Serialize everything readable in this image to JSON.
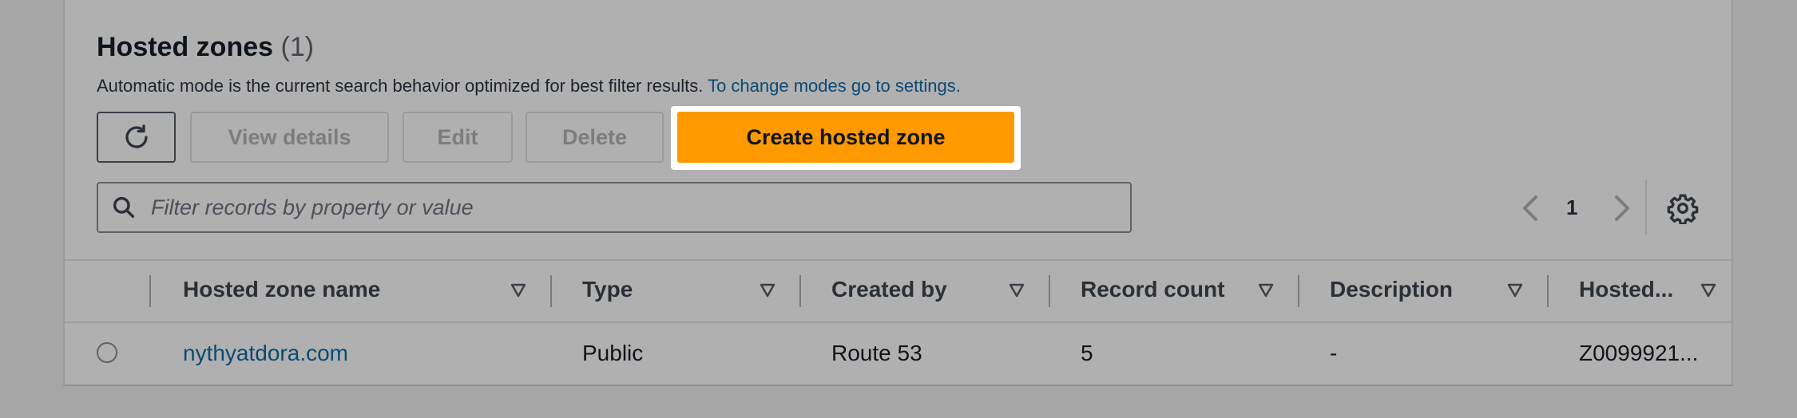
{
  "section": {
    "title": "Hosted zones",
    "count": "(1)",
    "description": "Automatic mode is the current search behavior optimized for best filter results.",
    "settings_link": "To change modes go to settings."
  },
  "toolbar": {
    "refresh_icon": "refresh-icon",
    "view_details_label": "View details",
    "edit_label": "Edit",
    "delete_label": "Delete",
    "create_label": "Create hosted zone",
    "create_color": "#ff9900"
  },
  "search": {
    "placeholder": "Filter records by property or value",
    "value": ""
  },
  "pagination": {
    "current_page": "1"
  },
  "table": {
    "columns": [
      {
        "label": "Hosted zone name"
      },
      {
        "label": "Type"
      },
      {
        "label": "Created by"
      },
      {
        "label": "Record count"
      },
      {
        "label": "Description"
      },
      {
        "label": "Hosted..."
      }
    ],
    "rows": [
      {
        "name": "nythyatdora.com",
        "type": "Public",
        "created_by": "Route 53",
        "record_count": "5",
        "description": "-",
        "hosted_zone_id": "Z0099921..."
      }
    ]
  },
  "colors": {
    "link": "#0a4a74",
    "accent": "#ff9900"
  }
}
